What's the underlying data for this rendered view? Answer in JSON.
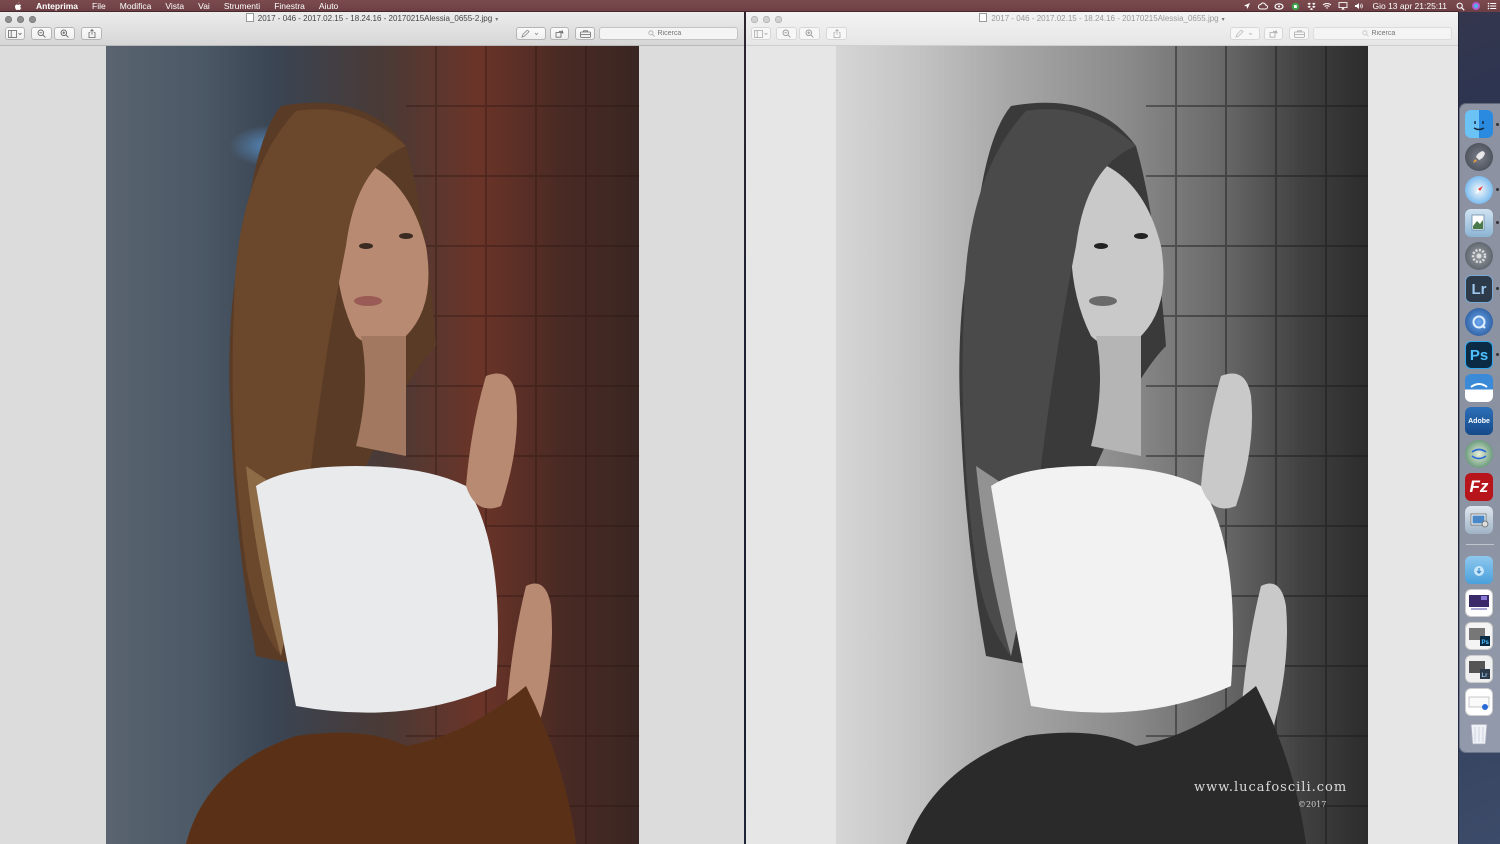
{
  "menubar": {
    "app_name": "Anteprima",
    "menus": [
      "File",
      "Modifica",
      "Vista",
      "Vai",
      "Strumenti",
      "Finestra",
      "Aiuto"
    ],
    "clock": "Gio 13 apr  21:25:11",
    "status_icons": [
      "location-icon",
      "cloud-sync-icon",
      "creative-cloud-icon",
      "evernote-icon",
      "dropbox-icon",
      "wifi-icon",
      "airplay-icon",
      "volume-icon"
    ]
  },
  "windows": {
    "left": {
      "title": "2017 - 046 - 2017.02.15 - 18.24.16 - 20170215Alessia_0655-2.jpg",
      "search_placeholder": "Ricerca",
      "active": true
    },
    "right": {
      "title": "2017 - 046 - 2017.02.15 - 18.24.16 - 20170215Alessia_0655.jpg",
      "search_placeholder": "Ricerca",
      "active": false
    }
  },
  "watermark": {
    "site": "www.lucafoscili.com",
    "year": "©2017"
  },
  "dock": {
    "apps": [
      {
        "name": "finder",
        "label": ""
      },
      {
        "name": "launchpad",
        "label": ""
      },
      {
        "name": "safari",
        "label": ""
      },
      {
        "name": "preview",
        "label": ""
      },
      {
        "name": "system-preferences",
        "label": ""
      },
      {
        "name": "lightroom",
        "label": "Lr"
      },
      {
        "name": "quicktime",
        "label": ""
      },
      {
        "name": "photoshop",
        "label": "Ps"
      },
      {
        "name": "cloud-app",
        "label": ""
      },
      {
        "name": "adobe-app",
        "label": "Adobe"
      },
      {
        "name": "gps-app",
        "label": ""
      },
      {
        "name": "filezilla",
        "label": "Fz"
      },
      {
        "name": "image-capture",
        "label": ""
      },
      {
        "name": "downloads-folder",
        "label": ""
      },
      {
        "name": "recent-doc-1",
        "label": ""
      },
      {
        "name": "recent-doc-ps",
        "label": "Ps"
      },
      {
        "name": "recent-doc-lr",
        "label": "Lr"
      },
      {
        "name": "recent-doc-mail",
        "label": ""
      },
      {
        "name": "trash",
        "label": ""
      }
    ]
  }
}
